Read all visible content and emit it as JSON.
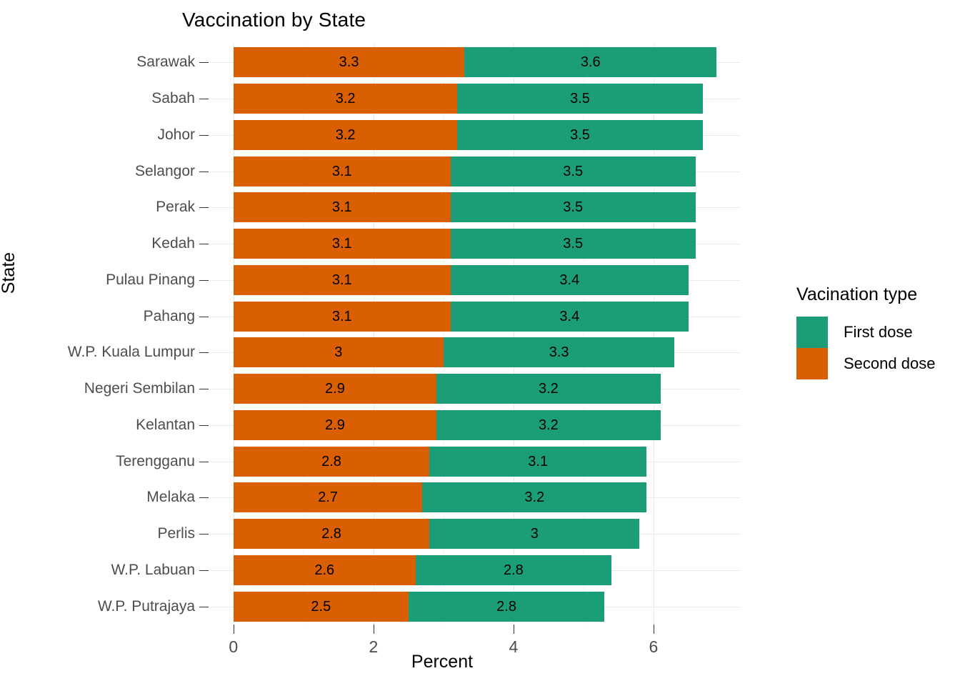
{
  "title": "Vaccination by State",
  "axes": {
    "x_title": "Percent",
    "y_title": "State",
    "x_ticks": [
      "0",
      "2",
      "4",
      "6"
    ],
    "x_tick_values": [
      0,
      2,
      4,
      6
    ],
    "x_minor_values": [
      1,
      3,
      5
    ],
    "x_min": -0.345,
    "x_max": 7.245
  },
  "legend": {
    "title": "Vacination type",
    "items": [
      {
        "label": "First dose",
        "color": "#1B9E77"
      },
      {
        "label": "Second dose",
        "color": "#D95F02"
      }
    ]
  },
  "colors": {
    "first_dose": "#1B9E77",
    "second_dose": "#D95F02",
    "panel_background": "#FFFFFF",
    "gridline_major": "#EBEBEB",
    "gridline_minor": "#F5F5F5",
    "axis_text": "#4D4D4D",
    "title_text": "#000000"
  },
  "chart_data": {
    "type": "bar",
    "orientation": "horizontal",
    "stacked": true,
    "title": "Vaccination by State",
    "xlabel": "Percent",
    "ylabel": "State",
    "xlim": [
      0,
      6
    ],
    "grid": true,
    "legend_position": "right",
    "legend_title": "Vacination type",
    "categories": [
      "Sarawak",
      "Sabah",
      "Johor",
      "Selangor",
      "Perak",
      "Kedah",
      "Pulau Pinang",
      "Pahang",
      "W.P. Kuala Lumpur",
      "Negeri Sembilan",
      "Kelantan",
      "Terengganu",
      "Melaka",
      "Perlis",
      "W.P. Labuan",
      "W.P. Putrajaya"
    ],
    "series": [
      {
        "name": "Second dose",
        "color": "#D95F02",
        "values": [
          3.3,
          3.2,
          3.2,
          3.1,
          3.1,
          3.1,
          3.1,
          3.1,
          3,
          2.9,
          2.9,
          2.8,
          2.7,
          2.8,
          2.6,
          2.5
        ],
        "labels": [
          "3.3",
          "3.2",
          "3.2",
          "3.1",
          "3.1",
          "3.1",
          "3.1",
          "3.1",
          "3",
          "2.9",
          "2.9",
          "2.8",
          "2.7",
          "2.8",
          "2.6",
          "2.5"
        ]
      },
      {
        "name": "First dose",
        "color": "#1B9E77",
        "values": [
          3.6,
          3.5,
          3.5,
          3.5,
          3.5,
          3.5,
          3.4,
          3.4,
          3.3,
          3.2,
          3.2,
          3.1,
          3.2,
          3,
          2.8,
          2.8
        ],
        "labels": [
          "3.6",
          "3.5",
          "3.5",
          "3.5",
          "3.5",
          "3.5",
          "3.4",
          "3.4",
          "3.3",
          "3.2",
          "3.2",
          "3.1",
          "3.2",
          "3",
          "2.8",
          "2.8"
        ]
      }
    ],
    "totals": [
      6.9,
      6.7,
      6.7,
      6.6,
      6.6,
      6.6,
      6.5,
      6.5,
      6.3,
      6.1,
      6.1,
      5.9,
      5.9,
      5.8,
      5.4,
      5.3
    ]
  }
}
